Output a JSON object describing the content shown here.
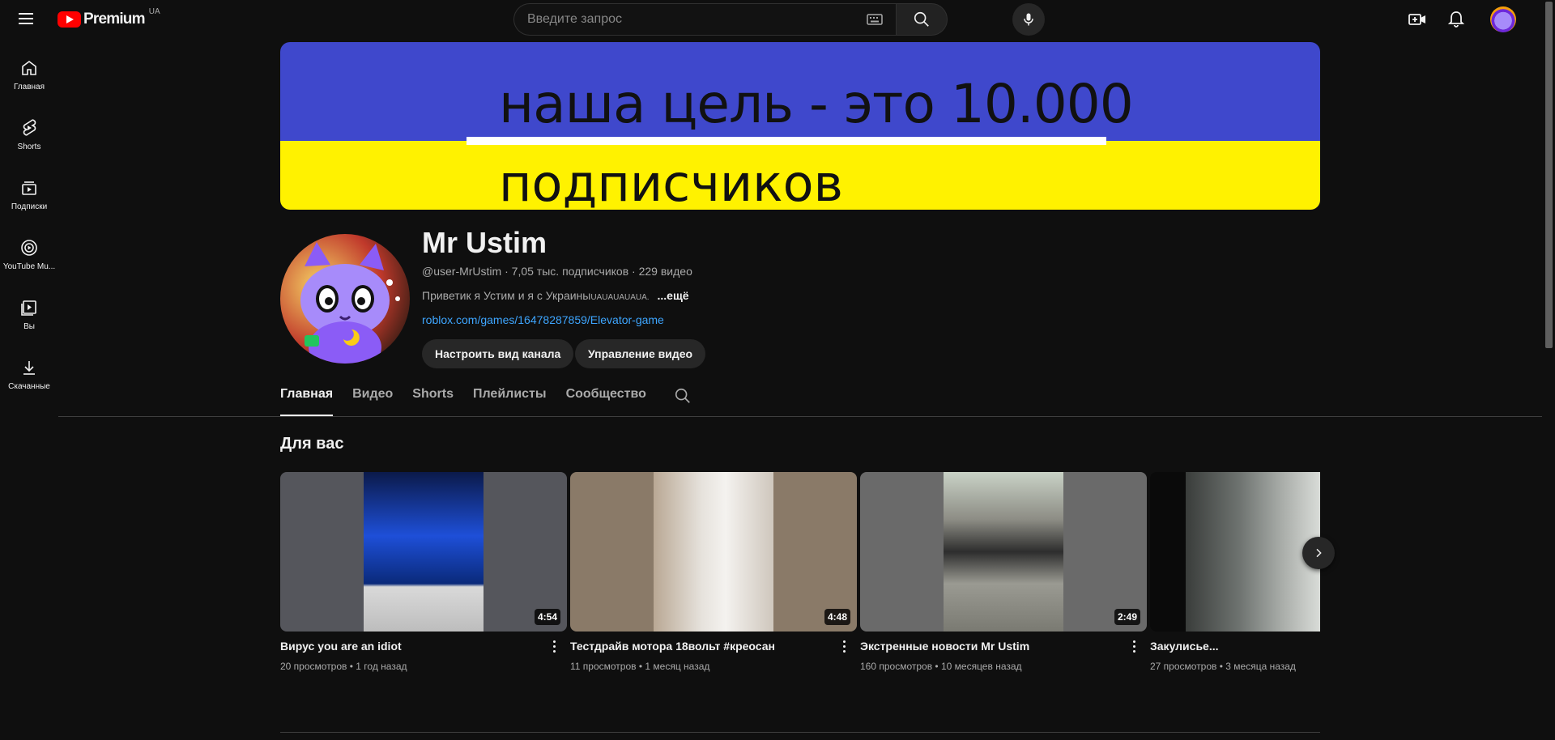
{
  "header": {
    "logo_text": "Premium",
    "country_code": "UA",
    "search_placeholder": "Введите запрос",
    "icons": [
      "menu-icon",
      "keyboard-icon",
      "search-icon",
      "mic-icon",
      "create-icon",
      "bell-icon"
    ]
  },
  "sidebar": {
    "items": [
      {
        "label": "Главная",
        "icon": "home-icon"
      },
      {
        "label": "Shorts",
        "icon": "shorts-icon"
      },
      {
        "label": "Подписки",
        "icon": "subscriptions-icon"
      },
      {
        "label": "YouTube Mu...",
        "icon": "music-icon"
      },
      {
        "label": "Вы",
        "icon": "library-icon"
      },
      {
        "label": "Скачанные",
        "icon": "download-icon"
      }
    ]
  },
  "banner": {
    "line1": "наша цель - это 10.000",
    "line2": "подписчиков",
    "colors": {
      "top": "#3f48cc",
      "bottom": "#fff200"
    }
  },
  "channel": {
    "name": "Mr Ustim",
    "handle": "@user-MrUstim",
    "subscribers": "7,05 тыс. подписчиков",
    "video_count": "229 видео",
    "description": "Приветик я Устим и я с Украины",
    "description_small": "UAUAUAUAUA.",
    "more": "...ещё",
    "link": "roblox.com/games/16478287859/Elevator-game",
    "buttons": {
      "customize": "Настроить вид канала",
      "manage": "Управление видео"
    }
  },
  "tabs": [
    "Главная",
    "Видео",
    "Shorts",
    "Плейлисты",
    "Сообщество"
  ],
  "section": {
    "title": "Для вас"
  },
  "videos": [
    {
      "title": "Вирус you are an idiot",
      "duration": "4:54",
      "views": "20 просмотров",
      "age": "1 год назад"
    },
    {
      "title": "Тестдрайв мотора 18вольт #креосан",
      "duration": "4:48",
      "views": "11 просмотров",
      "age": "1 месяц назад"
    },
    {
      "title": "Экстренные новости Mr Ustim",
      "duration": "2:49",
      "views": "160 просмотров",
      "age": "10 месяцев назад"
    },
    {
      "title": "Закулисье...",
      "duration": "",
      "views": "27 просмотров",
      "age": "3 месяца назад"
    }
  ],
  "colors": {
    "accent": "#ff0000",
    "link": "#3ea6ff",
    "background": "#0f0f0f"
  }
}
